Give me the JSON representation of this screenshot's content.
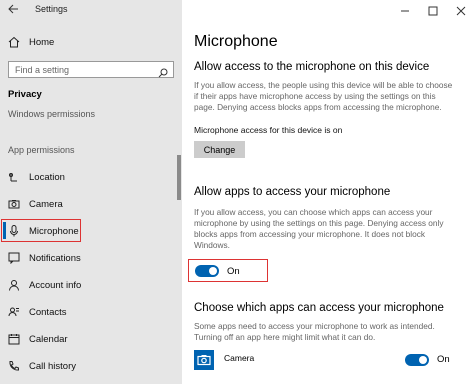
{
  "window": {
    "title": "Settings"
  },
  "sidebar": {
    "home_label": "Home",
    "search_placeholder": "Find a setting",
    "section_title": "Privacy",
    "windows_permissions": "Windows permissions",
    "app_permissions": "App permissions",
    "items": [
      {
        "label": "Location",
        "icon": "location-icon"
      },
      {
        "label": "Camera",
        "icon": "camera-icon"
      },
      {
        "label": "Microphone",
        "icon": "microphone-icon",
        "selected": true
      },
      {
        "label": "Notifications",
        "icon": "notifications-icon"
      },
      {
        "label": "Account info",
        "icon": "account-info-icon"
      },
      {
        "label": "Contacts",
        "icon": "contacts-icon"
      },
      {
        "label": "Calendar",
        "icon": "calendar-icon"
      },
      {
        "label": "Call history",
        "icon": "call-history-icon"
      }
    ]
  },
  "main": {
    "page_title": "Microphone",
    "device_section": {
      "heading": "Allow access to the microphone on this device",
      "description": "If you allow access, the people using this device will be able to choose if their apps have microphone access by using the settings on this page. Denying access blocks apps from accessing the microphone.",
      "status": "Microphone access for this device is on",
      "change_button": "Change"
    },
    "apps_section": {
      "heading": "Allow apps to access your microphone",
      "description": "If you allow access, you can choose which apps can access your microphone by using the settings on this page. Denying access only blocks apps from accessing your microphone. It does not block Windows.",
      "toggle_label": "On",
      "toggle_on": true
    },
    "choose_section": {
      "heading": "Choose which apps can access your microphone",
      "description": "Some apps need to access your microphone to work as intended. Turning off an app here might limit what it can do.",
      "apps": [
        {
          "name": "Camera",
          "toggle_label": "On",
          "toggle_on": true
        }
      ]
    }
  },
  "colors": {
    "accent": "#0063b1",
    "highlight_outline": "#dd3333",
    "sidebar_bg": "#e6e6e6"
  }
}
